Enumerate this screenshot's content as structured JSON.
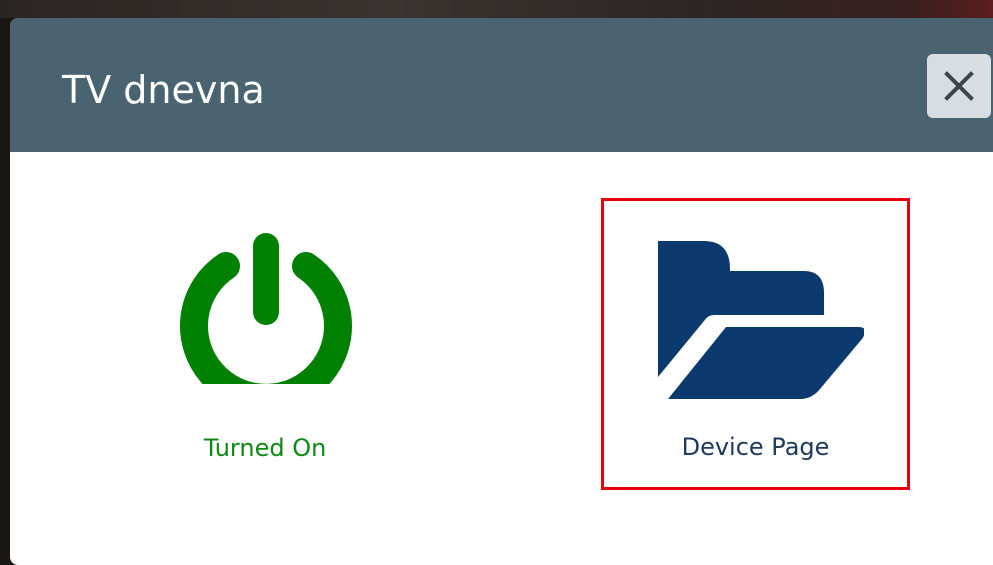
{
  "dialog": {
    "title": "TV dnevna",
    "close_icon": "close-icon"
  },
  "actions": [
    {
      "label": "Turned On",
      "icon": "power-icon",
      "color": "#008000",
      "state": "on"
    },
    {
      "label": "Device Page",
      "icon": "folder-open-icon",
      "color": "#0d3a6e",
      "selected": true
    }
  ],
  "colors": {
    "header": "#496470",
    "power_on": "#008000",
    "folder": "#0d3a6e",
    "selection": "#e8000b"
  }
}
